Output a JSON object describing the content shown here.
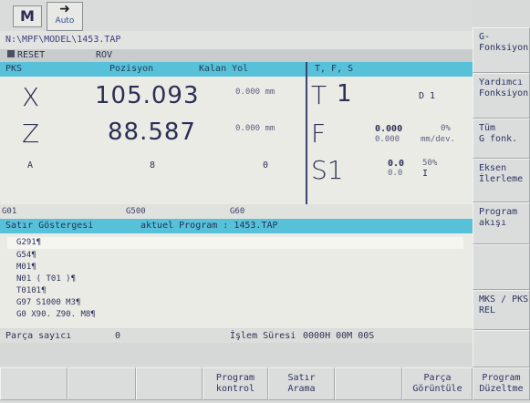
{
  "topbar": {
    "mode_letter": "M",
    "auto_label": "Auto",
    "auto_arrow": "➜"
  },
  "path": "N:\\MPF\\MODEL\\1453.TAP",
  "status": {
    "reset": "RESET",
    "rov": "ROV"
  },
  "pos_header": {
    "pks": "PKS",
    "pozisyon": "Pozisyon",
    "kalan_yol": "Kalan Yol"
  },
  "tfs_header": "T, F, S",
  "axes": [
    {
      "name": "X",
      "value": "105.093",
      "remaining": "0.000 mm"
    },
    {
      "name": "Z",
      "value": "88.587",
      "remaining": "0.000 mm"
    },
    {
      "name": "A",
      "value": "8",
      "remaining": "0"
    }
  ],
  "tfs": {
    "t_label": "T",
    "t_value": "1",
    "d_value": "D 1",
    "f_label": "F",
    "f_val1": "0.000",
    "f_val2": "0.000",
    "f_pct": "0%",
    "f_unit": "mm/dev.",
    "s_label": "S1",
    "s_val1": "0.0",
    "s_val2": "0.0",
    "s_pct": "50%",
    "s_mark": "I"
  },
  "gcodes": {
    "g1": "G01",
    "g2": "G500",
    "g3": "G60"
  },
  "program_header": {
    "left": "Satır Göstergesi",
    "right": "aktuel Program : 1453.TAP"
  },
  "program_lines": [
    "G291¶",
    "G54¶",
    "M01¶",
    "N01  ( T01 )¶",
    "T0101¶",
    "G97 S1000 M3¶",
    "G0 X90. Z90. M8¶"
  ],
  "counter": {
    "label": "Parça sayıcı",
    "value": "0",
    "time_label": "İşlem Süresi",
    "time_value": "0000H 00M 00S"
  },
  "bottom_keys": [
    {
      "label": ""
    },
    {
      "label": ""
    },
    {
      "label": ""
    },
    {
      "label": "Program\nkontrol"
    },
    {
      "label": "Satır\nArama"
    },
    {
      "label": ""
    },
    {
      "label": "Parça\nGörüntüle"
    },
    {
      "label": "Program\nDüzeltme"
    }
  ],
  "side_keys": [
    {
      "label": "G-\nFonksiyon"
    },
    {
      "label": "Yardımcı\nFonksiyon"
    },
    {
      "label": "Tüm\nG fonk."
    },
    {
      "label": "Eksen\nİlerleme"
    },
    {
      "label": "Program\nakışı"
    },
    {
      "label": ""
    },
    {
      "label": "MKS / PKS\nREL"
    },
    {
      "label": ""
    }
  ],
  "colors": {
    "header_cyan": "#58c1da",
    "panel": "#ebebe5",
    "text": "#2a2f55"
  }
}
